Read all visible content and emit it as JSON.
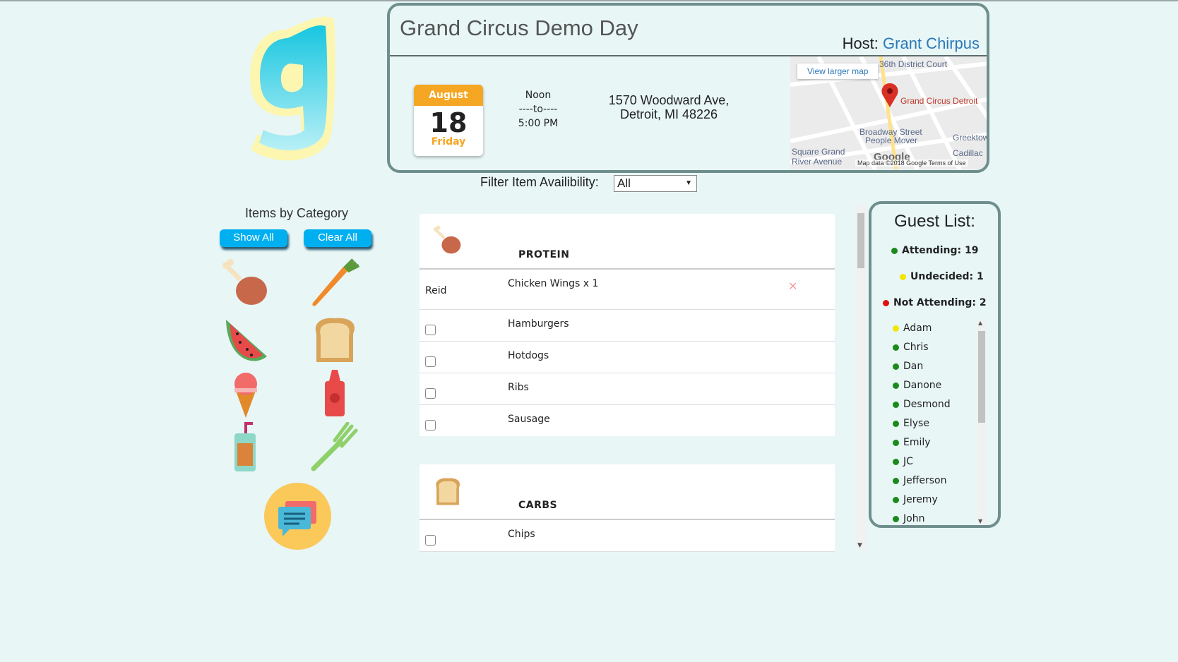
{
  "event": {
    "title": "Grand Circus Demo Day",
    "host_label": "Host:",
    "host_name": "Grant Chirpus",
    "calendar": {
      "month": "August",
      "day": "18",
      "weekday": "Friday"
    },
    "time": {
      "start": "Noon",
      "sep": "----to----",
      "end": "5:00 PM"
    },
    "address": {
      "line1": "1570 Woodward Ave,",
      "line2": "Detroit, MI 48226"
    },
    "map": {
      "link": "View larger map",
      "pin_label": "Grand Circus Detroit",
      "labels": [
        "36th District Court",
        "Broadway Street",
        "People Mover",
        "Greektown",
        "Cadillac",
        "Square Grand",
        "River Avenue"
      ],
      "brand": "Google",
      "footer": "Map data ©2018 Google   Terms of Use"
    }
  },
  "filter": {
    "label": "Filter Item Availibility:",
    "value": "All"
  },
  "sidebar": {
    "title": "Items by Category",
    "show_all": "Show All",
    "clear_all": "Clear All",
    "icons": [
      "drumstick-icon",
      "carrot-icon",
      "watermelon-icon",
      "bread-icon",
      "ice-cream-icon",
      "ketchup-icon",
      "drink-icon",
      "fork-icon"
    ],
    "chat_icon": "chat-icon"
  },
  "categories": [
    {
      "name": "PROTEIN",
      "icon": "drumstick-icon",
      "rows": [
        {
          "who": "Reid",
          "item": "Chicken Wings x 1",
          "claimed": true
        },
        {
          "who": "",
          "item": "Hamburgers",
          "claimed": false
        },
        {
          "who": "",
          "item": "Hotdogs",
          "claimed": false
        },
        {
          "who": "",
          "item": "Ribs",
          "claimed": false
        },
        {
          "who": "",
          "item": "Sausage",
          "claimed": false
        }
      ]
    },
    {
      "name": "CARBS",
      "icon": "bread-icon",
      "rows": [
        {
          "who": "",
          "item": "Chips",
          "claimed": false
        }
      ]
    }
  ],
  "guest_list": {
    "title": "Guest List:",
    "attending": "Attending: 19",
    "undecided": "Undecided: 1",
    "not_attending": "Not Attending: 2",
    "guests": [
      {
        "name": "Adam",
        "status": "undecided"
      },
      {
        "name": "Chris",
        "status": "attending"
      },
      {
        "name": "Dan",
        "status": "attending"
      },
      {
        "name": "Danone",
        "status": "attending"
      },
      {
        "name": "Desmond",
        "status": "attending"
      },
      {
        "name": "Elyse",
        "status": "attending"
      },
      {
        "name": "Emily",
        "status": "attending"
      },
      {
        "name": "JC",
        "status": "attending"
      },
      {
        "name": "Jefferson",
        "status": "attending"
      },
      {
        "name": "Jeremy",
        "status": "attending"
      },
      {
        "name": "John",
        "status": "attending"
      }
    ]
  },
  "colors": {
    "background": "#e8f6f6",
    "accent": "#00aff0",
    "calendar": "#f5a623",
    "attending": "#1a8a1a",
    "undecided": "#f2e600",
    "not_attending": "#e01010"
  }
}
